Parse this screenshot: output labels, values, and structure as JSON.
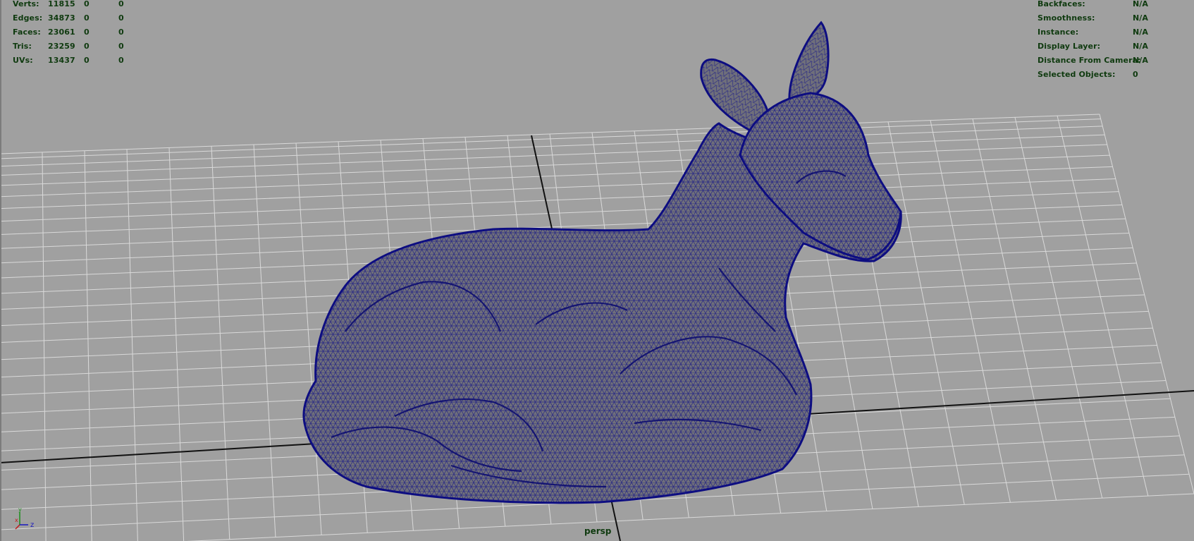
{
  "viewport": {
    "camera": "persp",
    "background_color": "#a0a0a0",
    "grid_color": "#d9d9d9",
    "axis_color": "#111111",
    "wireframe_color": "#10108a",
    "mesh_fill_color": "#6e6e78",
    "object": "deer-wireframe-mesh"
  },
  "poly_count": {
    "rows": [
      {
        "label": "Verts:",
        "values": [
          "11815",
          "0",
          "0"
        ]
      },
      {
        "label": "Edges:",
        "values": [
          "34873",
          "0",
          "0"
        ]
      },
      {
        "label": "Faces:",
        "values": [
          "23061",
          "0",
          "0"
        ]
      },
      {
        "label": "Tris:",
        "values": [
          "23259",
          "0",
          "0"
        ]
      },
      {
        "label": "UVs:",
        "values": [
          "13437",
          "0",
          "0"
        ]
      }
    ]
  },
  "object_details": {
    "rows": [
      {
        "label": "Backfaces:",
        "value": "N/A"
      },
      {
        "label": "Smoothness:",
        "value": "N/A"
      },
      {
        "label": "Instance:",
        "value": "N/A"
      },
      {
        "label": "Display Layer:",
        "value": "N/A"
      },
      {
        "label": "Distance From Camera:",
        "value": "N/A"
      },
      {
        "label": "Selected Objects:",
        "value": "0"
      }
    ]
  },
  "axis_gizmo": {
    "y_label": "y",
    "x_label": "x",
    "z_label": "z",
    "y_color": "#1a8f1a",
    "x_color": "#c01818",
    "z_color": "#1818c0"
  }
}
